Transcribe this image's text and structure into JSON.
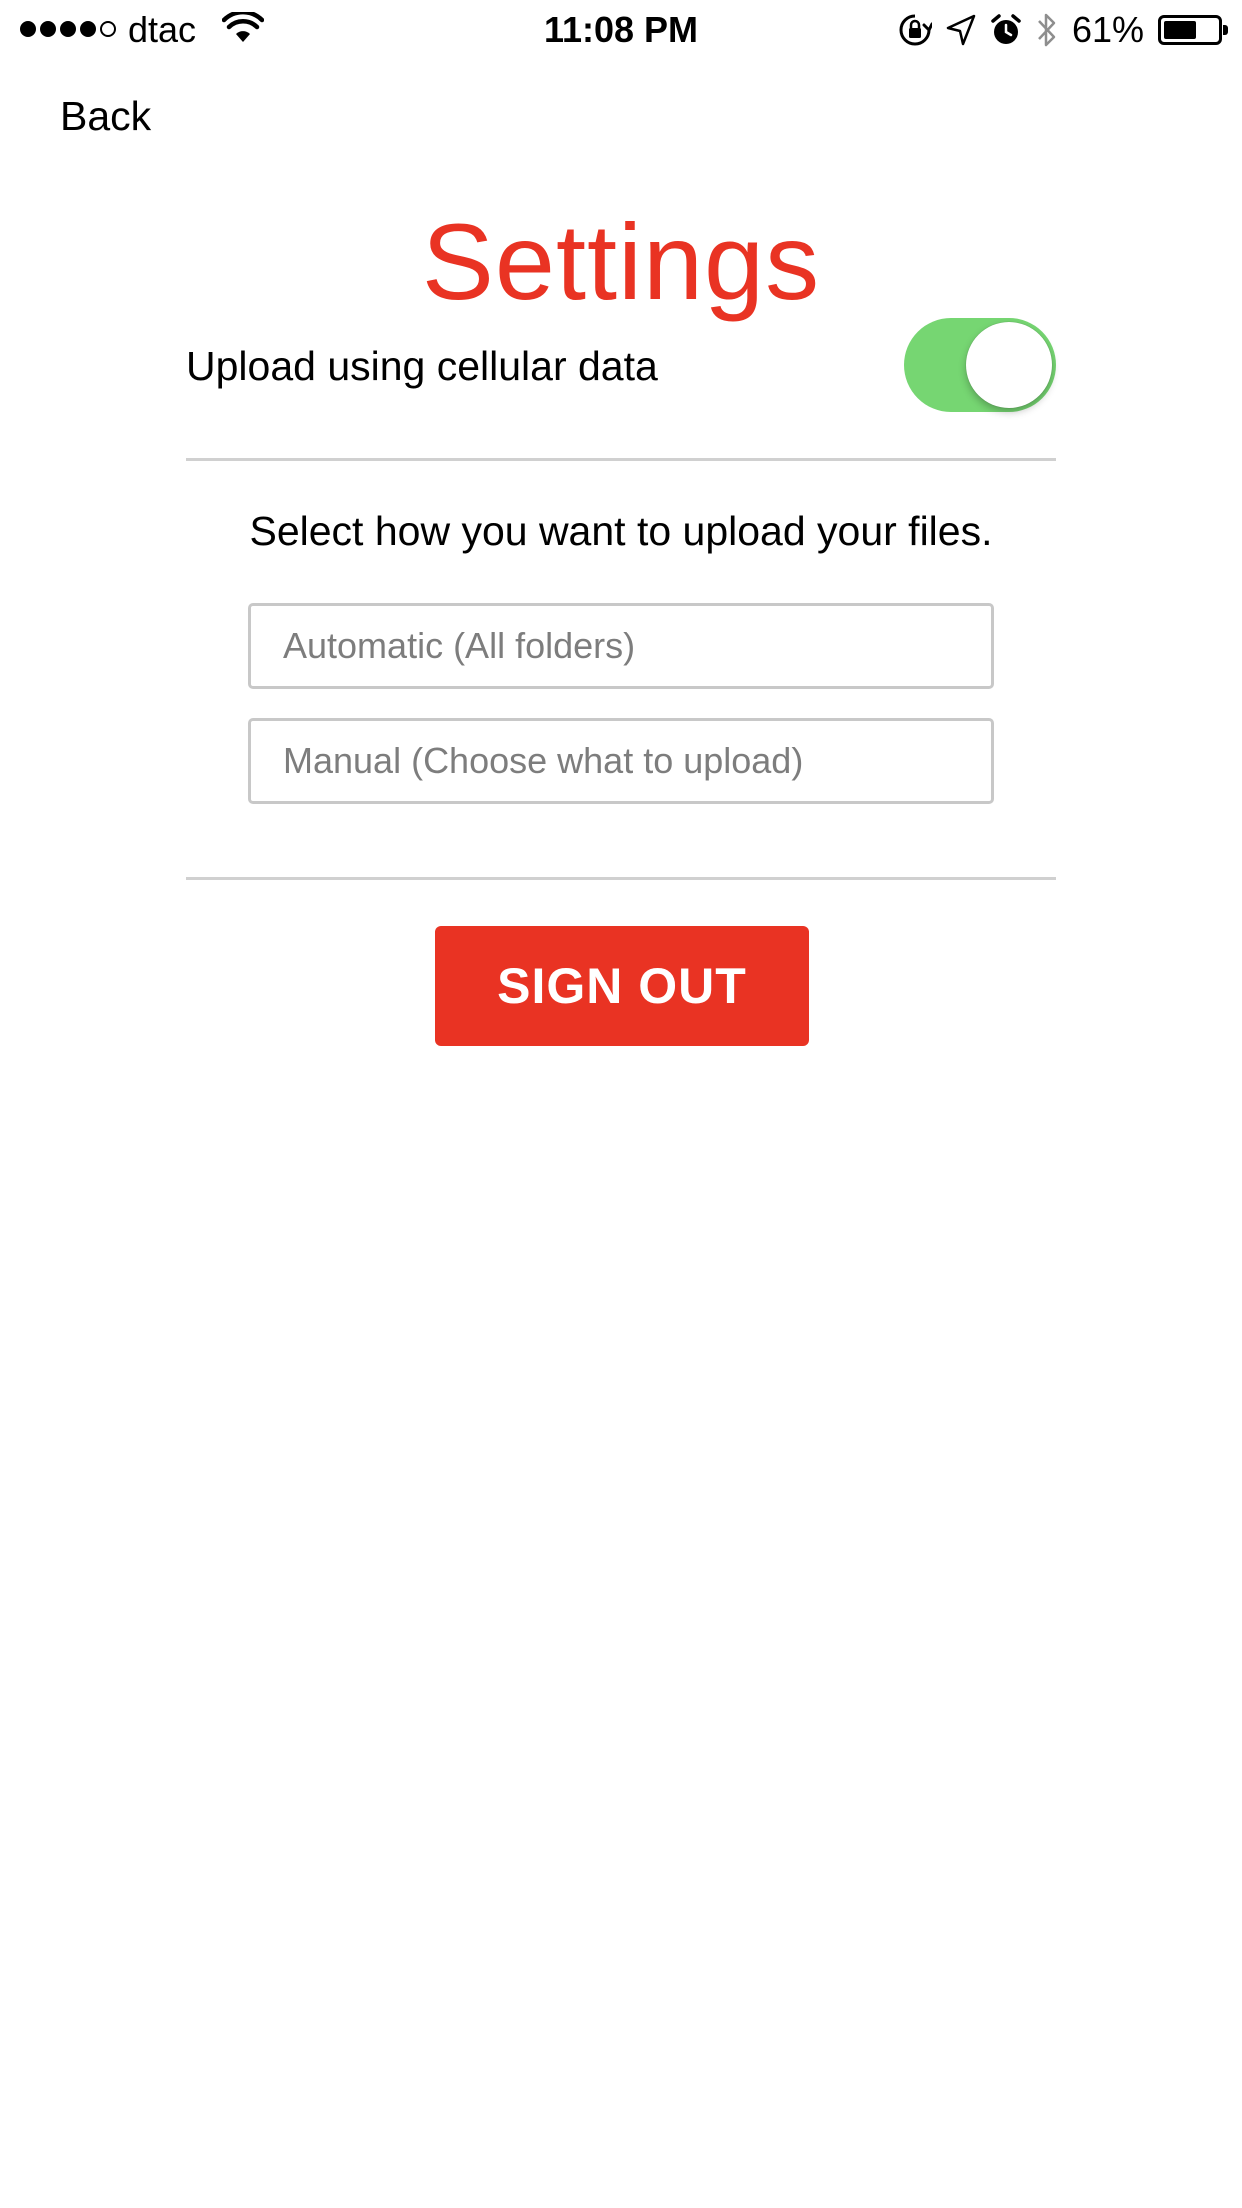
{
  "status_bar": {
    "signal_bars_filled": 4,
    "signal_bars_total": 5,
    "carrier": "dtac",
    "time": "11:08 PM",
    "battery_percent": "61%",
    "battery_level": 0.61,
    "icons": [
      "wifi-icon",
      "orientation-lock-icon",
      "location-icon",
      "alarm-icon",
      "bluetooth-icon",
      "battery-icon"
    ]
  },
  "nav": {
    "back_label": "Back"
  },
  "title": "Settings",
  "cellular": {
    "label": "Upload using cellular data",
    "enabled": true
  },
  "upload_mode": {
    "prompt": "Select how you want to upload your files.",
    "automatic_placeholder": "Automatic (All folders)",
    "manual_placeholder": "Manual (Choose what to upload)"
  },
  "sign_out": {
    "label": "SIGN OUT"
  },
  "colors": {
    "accent_red": "#e93323",
    "toggle_on": "#76d672"
  }
}
